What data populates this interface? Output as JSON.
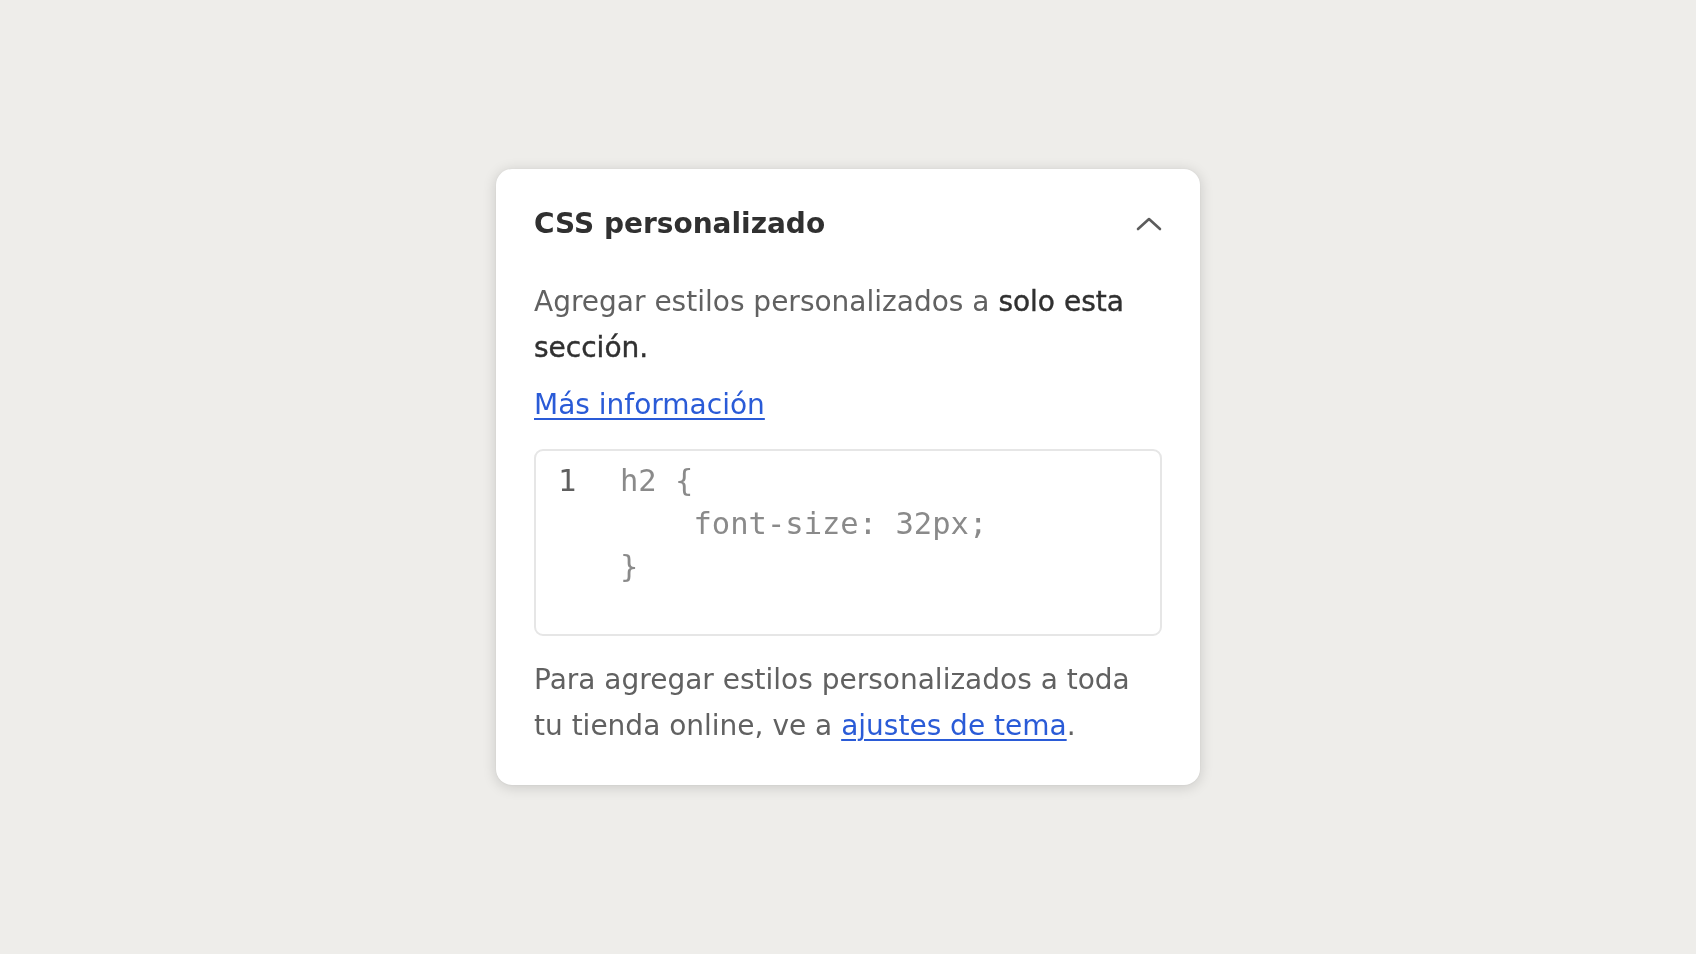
{
  "panel": {
    "title": "CSS personalizado",
    "expanded": true,
    "description": "Agregar estilos personalizados a **solo esta sección.**",
    "learn_more_link": "Más información",
    "code_editor": {
      "lines": [
        {
          "number": "1",
          "text": "h2 {"
        },
        {
          "text": "    font-size: 32px;"
        },
        {
          "text": "}"
        }
      ]
    },
    "footer": {
      "text": "Para agregar estilos personalizados a toda tu tienda online, ve a ",
      "link": "ajustes de tema",
      "text_after": "."
    }
  }
}
